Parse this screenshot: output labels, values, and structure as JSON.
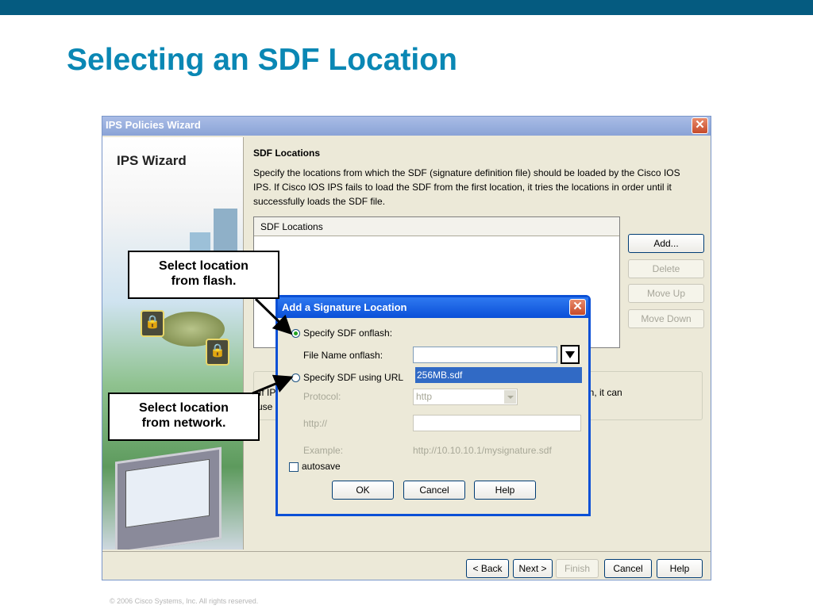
{
  "slide": {
    "title": "Selecting an SDF Location",
    "footer": "© 2006 Cisco Systems, Inc. All rights reserved."
  },
  "wizard": {
    "title": "IPS Policies Wizard",
    "side_title": "IPS Wizard",
    "section_title": "SDF Locations",
    "description": "Specify the locations from which the SDF (signature definition file) should be loaded by the Cisco IOS IPS. If Cisco IOS IPS fails to load the SDF from the first location, it tries the locations in order until it successfully loads the SDF file.",
    "list_header": "SDF Locations",
    "buttons": {
      "add": "Add...",
      "delete": "Delete",
      "move_up": "Move Up",
      "move_down": "Move Down"
    },
    "partial_text": {
      "line1": "If IP",
      "line2": "use",
      "line3": "on, it can"
    },
    "nav": {
      "back": "< Back",
      "next": "Next >",
      "finish": "Finish",
      "cancel": "Cancel",
      "help": "Help"
    }
  },
  "dialog": {
    "title": "Add a Signature Location",
    "opt_flash": "Specify SDF onflash:",
    "file_name_label": "File Name onflash:",
    "file_name_value": "",
    "dropdown_option": "256MB.sdf",
    "opt_url": "Specify SDF using URL",
    "protocol_label": "Protocol:",
    "protocol_value": "http",
    "http_label": "http://",
    "http_value": "",
    "example_label": "Example:",
    "example_value": "http://10.10.10.1/mysignature.sdf",
    "autosave": "autosave",
    "ok": "OK",
    "cancel": "Cancel",
    "help": "Help"
  },
  "callouts": {
    "flash": {
      "line1": "Select location",
      "line2": "from flash."
    },
    "network": {
      "line1": "Select location",
      "line2": "from network."
    }
  },
  "colors": {
    "header_band": "#055b80",
    "title": "#0a87b4",
    "dialog_border": "#0b50d6",
    "selection": "#316ac5"
  }
}
